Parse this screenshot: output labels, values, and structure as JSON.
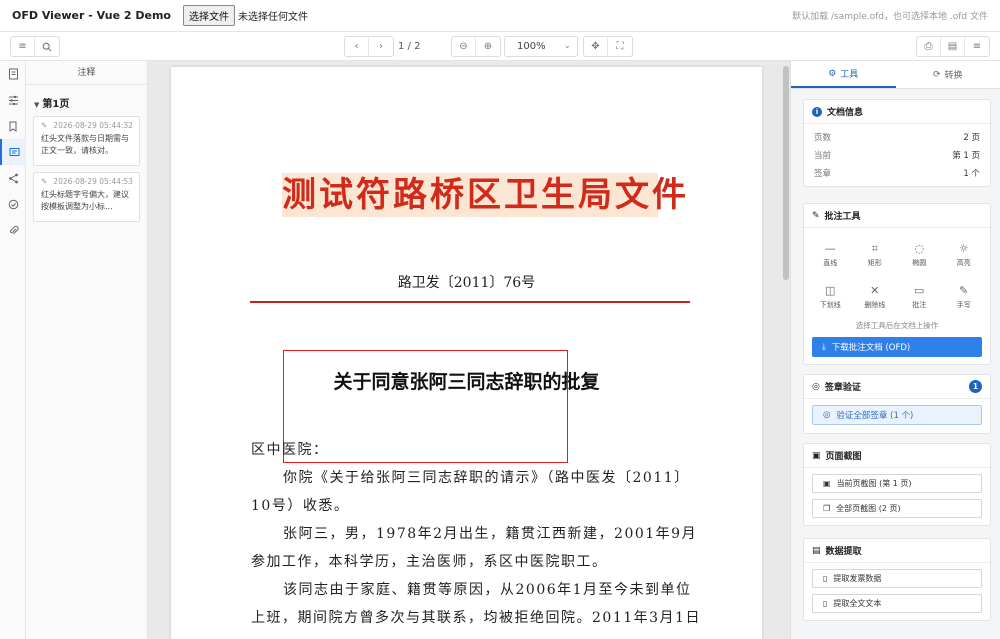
{
  "topbar": {
    "app_title": "OFD Viewer - Vue 2 Demo",
    "file_button": "选择文件",
    "file_status": "未选择任何文件",
    "hint": "默认加载 /sample.ofd，也可选择本地 .ofd 文件"
  },
  "toolbar": {
    "page_indicator": "1 / 2",
    "zoom": "100%"
  },
  "annotations": {
    "title": "注释",
    "group": "第1页",
    "items": [
      {
        "time": "2026-08-29 05:44:32",
        "text": "红头文件落款与日期需与正文一致，请核对。"
      },
      {
        "time": "2026-08-29 05:44:53",
        "text": "红头标题字号偏大，建议按模板调整为小标..."
      }
    ]
  },
  "document": {
    "red_title": "测试符路桥区卫生局文件",
    "doc_number": "路卫发〔2011〕76号",
    "heading": "关于同意张阿三同志辞职的批复",
    "p1": "区中医院：",
    "p2": "你院《关于给张阿三同志辞职的请示》（路中医发〔2011〕10号）收悉。",
    "p3": "张阿三，男，1978年2月出生，籍贯江西新建，2001年9月参加工作，本科学历，主治医师，系区中医院职工。",
    "p4": "该同志由于家庭、籍贯等原因，从2006年1月至今未到单位上班，期间院方曾多次与其联系，均被拒绝回院。2011年3月1日"
  },
  "right_panel": {
    "tabs": {
      "tools": "工具",
      "convert": "转换"
    },
    "doc_info": {
      "title": "文档信息",
      "rows": [
        {
          "k": "页数",
          "v": "2 页"
        },
        {
          "k": "当前",
          "v": "第 1 页"
        },
        {
          "k": "签章",
          "v": "1 个"
        }
      ]
    },
    "annot_tools": {
      "title": "批注工具",
      "tools": [
        "直线",
        "矩形",
        "椭圆",
        "高亮",
        "下划线",
        "删除线",
        "批注",
        "手写"
      ],
      "hint": "选择工具后在文档上操作",
      "download": "下载批注文档 (OFD)"
    },
    "sig_verify": {
      "title": "签章验证",
      "badge": "1",
      "button": "验证全部签章 (1 个)"
    },
    "screenshot": {
      "title": "页面截图",
      "current": "当前页截图 (第 1 页)",
      "all": "全部页截图 (2 页)"
    },
    "extract": {
      "title": "数据提取",
      "invoice": "提取发票数据",
      "fulltext": "提取全文文本"
    }
  }
}
